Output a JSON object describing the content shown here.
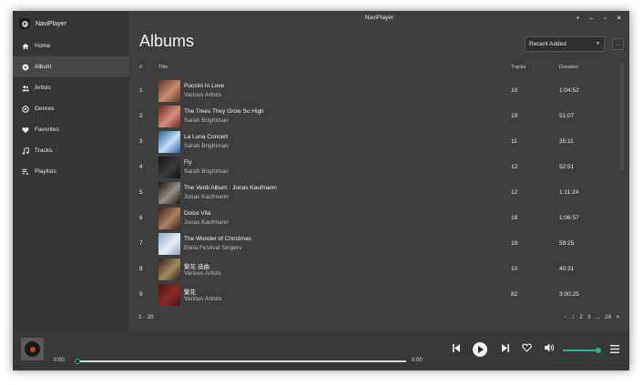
{
  "app": {
    "name": "NaviPlayer",
    "window_title": "NaviPlayer"
  },
  "window_controls": [
    "•",
    "–",
    "▫",
    "✕"
  ],
  "sidebar": {
    "items": [
      {
        "label": "Home",
        "icon": "home-icon"
      },
      {
        "label": "Album",
        "icon": "album-icon",
        "active": true
      },
      {
        "label": "Artists",
        "icon": "artists-icon"
      },
      {
        "label": "Genres",
        "icon": "genres-icon"
      },
      {
        "label": "Favorites",
        "icon": "heart-icon"
      },
      {
        "label": "Tracks",
        "icon": "music-note-icon"
      },
      {
        "label": "Playlists",
        "icon": "playlist-icon"
      }
    ]
  },
  "main": {
    "title": "Albums",
    "sort": {
      "selected": "Recent Added"
    },
    "more_label": "...",
    "table": {
      "headers": {
        "num": "#",
        "title": "Title",
        "tracks": "Tracks",
        "duration": "Duration"
      },
      "rows": [
        {
          "num": "1",
          "title": "Puccini In Love",
          "artist": "Various Artists",
          "tracks": "10",
          "duration": "1:04:52",
          "cover": [
            "#5a3a2c",
            "#c98b6b"
          ]
        },
        {
          "num": "2",
          "title": "The Trees They Grow So High",
          "artist": "Sarah Brightman",
          "tracks": "19",
          "duration": "51:07",
          "cover": [
            "#6a2a22",
            "#d78c7a"
          ]
        },
        {
          "num": "3",
          "title": "La Luna Concert",
          "artist": "Sarah Brightman",
          "tracks": "11",
          "duration": "35:11",
          "cover": [
            "#2a5f9c",
            "#c4e0f7"
          ]
        },
        {
          "num": "4",
          "title": "Fly",
          "artist": "Sarah Brightman",
          "tracks": "12",
          "duration": "52:51",
          "cover": [
            "#141414",
            "#3a3a3a"
          ]
        },
        {
          "num": "5",
          "title": "The Verdi Album : Jonas Kaufmann",
          "artist": "Jonas Kaufmann",
          "tracks": "12",
          "duration": "1:11:24",
          "cover": [
            "#111111",
            "#9a8f86"
          ]
        },
        {
          "num": "6",
          "title": "Dolce Vita",
          "artist": "Jonas Kaufmann",
          "tracks": "18",
          "duration": "1:06:57",
          "cover": [
            "#3a2018",
            "#b08064"
          ]
        },
        {
          "num": "7",
          "title": "The Wonder of Christmas",
          "artist": "Elora Festival Singers",
          "tracks": "18",
          "duration": "59:25",
          "cover": [
            "#8fa6cc",
            "#e9eef7"
          ]
        },
        {
          "num": "8",
          "title": "繁花·选曲",
          "artist": "Various Artists",
          "tracks": "10",
          "duration": "40:31",
          "cover": [
            "#2a2118",
            "#a38a5e"
          ]
        },
        {
          "num": "9",
          "title": "繁花",
          "artist": "Various Artists",
          "tracks": "82",
          "duration": "3:00:25",
          "cover": [
            "#4a1414",
            "#8b2a2a"
          ]
        }
      ]
    },
    "range_text": "1 - 20",
    "pagination": {
      "prev": "<",
      "pages": [
        "1",
        "2",
        "3",
        "...",
        "24"
      ],
      "current": "1",
      "next": ">"
    }
  },
  "player": {
    "current_time": "0:00",
    "total_time": "0:00",
    "progress": 0,
    "volume": 1.0
  },
  "colors": {
    "accent": "#1abc9c",
    "background": "#3e3e3e",
    "sidebar": "#353535"
  }
}
